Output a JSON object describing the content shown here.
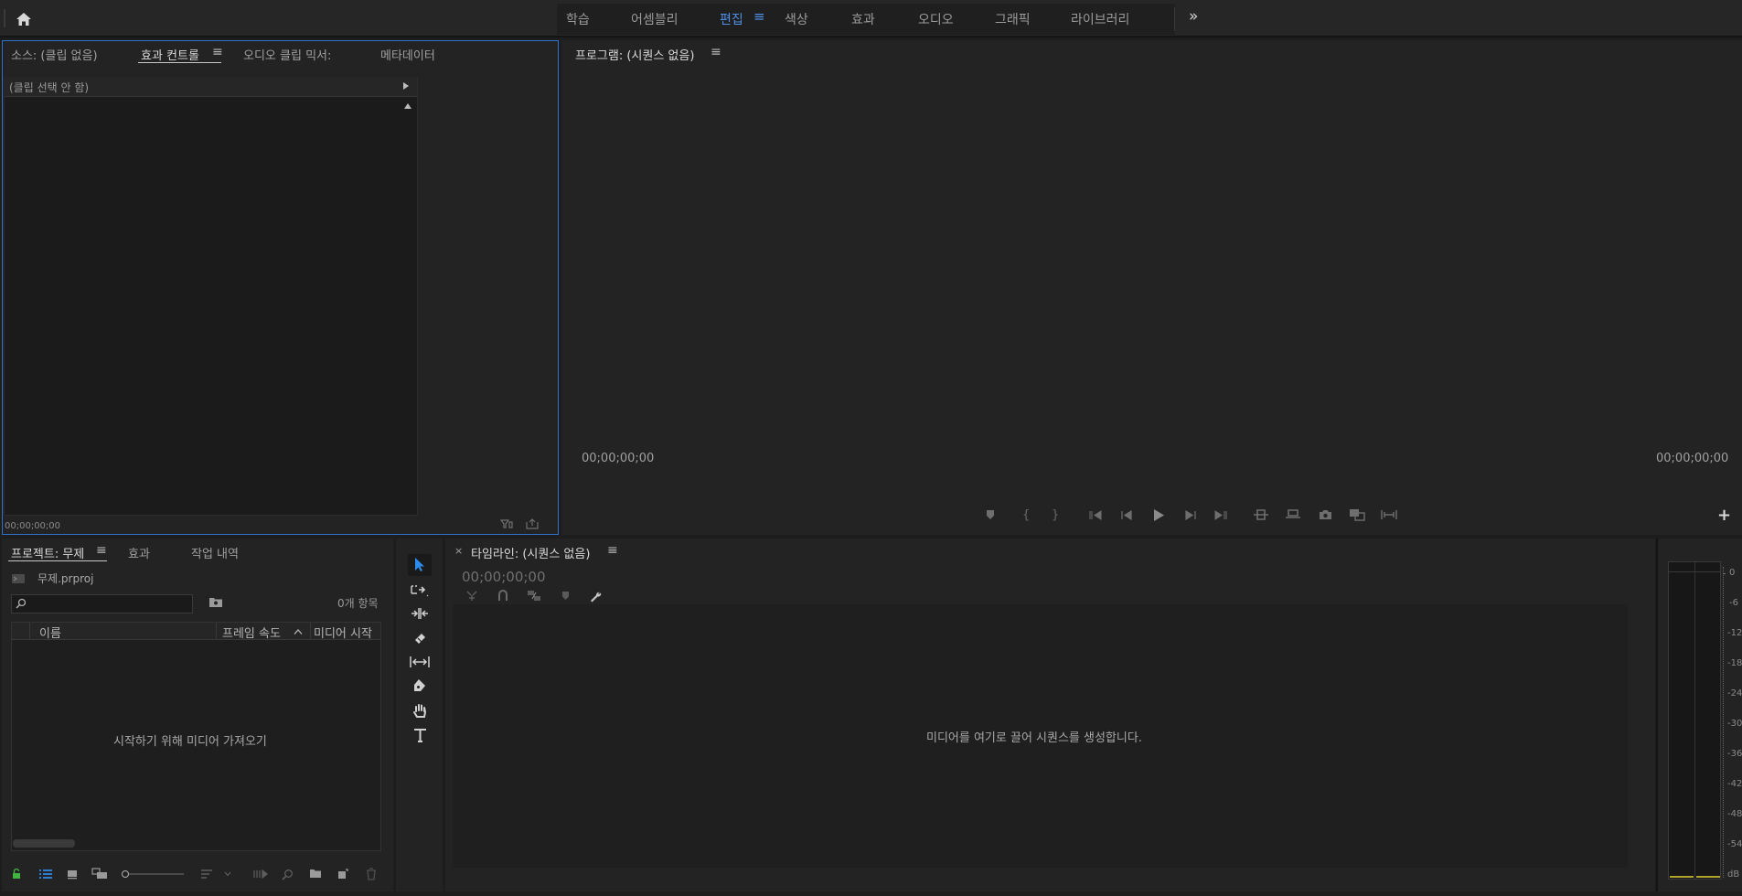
{
  "workspaces": {
    "tabs": [
      "학습",
      "어셈블리",
      "편집",
      "색상",
      "효과",
      "오디오",
      "그래픽",
      "라이브러리"
    ],
    "active": "편집",
    "more": "»"
  },
  "source_panel": {
    "tabs": [
      "소스: (클립 없음)",
      "효과 컨트롤",
      "오디오 클립 믹서:",
      "메타데이터"
    ],
    "active_tab": "효과 컨트롤",
    "no_clip": "(클립 선택 안 함)",
    "timecode": "00;00;00;00"
  },
  "program_panel": {
    "title": "프로그램: (시퀀스 없음)",
    "timecode_left": "00;00;00;00",
    "timecode_right": "00;00;00;00",
    "add_button": "+"
  },
  "project_panel": {
    "tabs": [
      "프로젝트: 무제",
      "효과",
      "작업 내역"
    ],
    "active_tab": "프로젝트: 무제",
    "file_name": "무제.prproj",
    "item_count": "0개 항목",
    "search_placeholder": "",
    "columns": [
      "이름",
      "프레임 속도",
      "미디어 시작"
    ],
    "empty_message": "시작하기 위해 미디어 가져오기"
  },
  "timeline_panel": {
    "title": "타임라인: (시퀀스 없음)",
    "close": "×",
    "timecode": "00;00;00;00",
    "empty_message": "미디어를 여기로 끌어 시퀀스를 생성합니다."
  },
  "audio_meters": {
    "scale": [
      "0",
      "-6",
      "-12",
      "-18",
      "-24",
      "-30",
      "-36",
      "-42",
      "-48",
      "-54",
      "dB"
    ]
  },
  "colors": {
    "accent": "#2d8ceb",
    "active_tab": "#4f8fe6",
    "panel_bg": "#232323",
    "app_bg": "#1d1d1d",
    "lock_green": "#3fb53f"
  },
  "menu_glyph": "≡"
}
